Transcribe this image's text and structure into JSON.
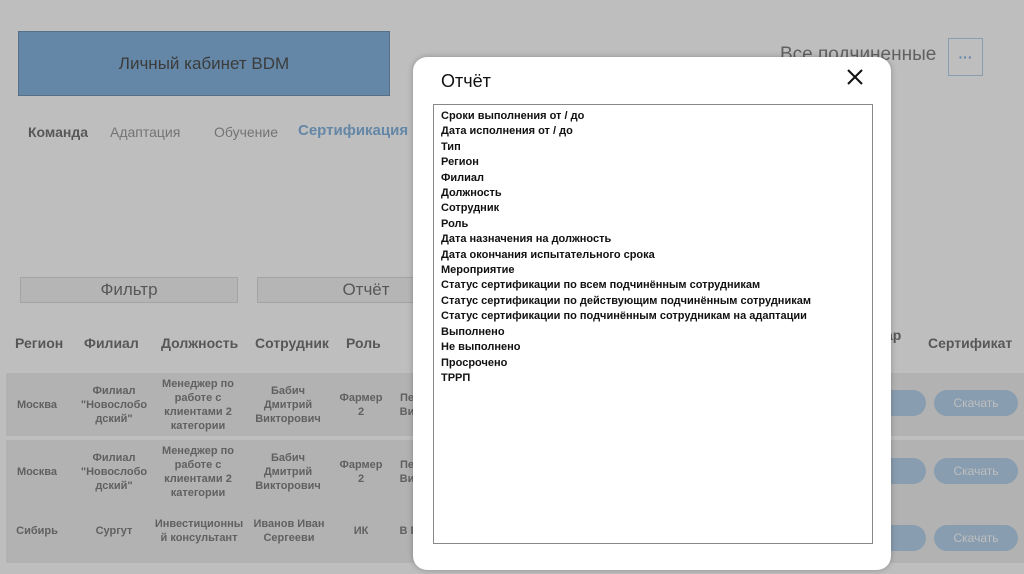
{
  "header": {
    "title": "Личный кабинет BDM",
    "subordinates_label": "Все подчиненные",
    "more_label": "···"
  },
  "tabs": [
    "Команда",
    "Адаптация",
    "Обучение",
    "Сертификация"
  ],
  "actions": {
    "filter_label": "Фильтр",
    "report_label": "Отчёт"
  },
  "table": {
    "columns": [
      "Регион",
      "Филиал",
      "Должность",
      "Сотрудник",
      "Роль",
      "ар",
      "Сертификат"
    ],
    "rows": [
      {
        "region": "Москва",
        "branch": "Филиал \"Новослобо дский\"",
        "position": "Менеджер по работе с клиентами 2 категории",
        "employee": "Бабич Дмитрий Викторович",
        "role": "Фармер 2",
        "partial": "Пе Ви",
        "download": "Скачать"
      },
      {
        "region": "Москва",
        "branch": "Филиал \"Новослобо дский\"",
        "position": "Менеджер по работе с клиентами 2 категории",
        "employee": "Бабич Дмитрий Викторович",
        "role": "Фармер 2",
        "partial": "Пе Ви",
        "download": "Скачать"
      },
      {
        "region": "Сибирь",
        "branch": "Сургут",
        "position": "Инвестиционны й консультант",
        "employee": "Иванов Иван Сергееви",
        "role": "ИК",
        "partial": "В П",
        "download": "Скачать"
      }
    ]
  },
  "modal": {
    "title": "Отчёт",
    "items": [
      "Сроки выполнения от / до",
      "Дата исполнения от / до",
      "Тип",
      "Регион",
      "Филиал",
      "Должность",
      "Сотрудник",
      "Роль",
      "Дата назначения на должность",
      "Дата окончания испытательного срока",
      "Мероприятие",
      "Статус сертификации по всем подчинённым сотрудникам",
      "Статус сертификации по действующим подчинённым сотрудникам",
      "Статус сертификации по подчинённым сотрудникам на адаптации",
      "Выполнено",
      "Не выполнено",
      "Просрочено",
      "ТРРП"
    ]
  }
}
